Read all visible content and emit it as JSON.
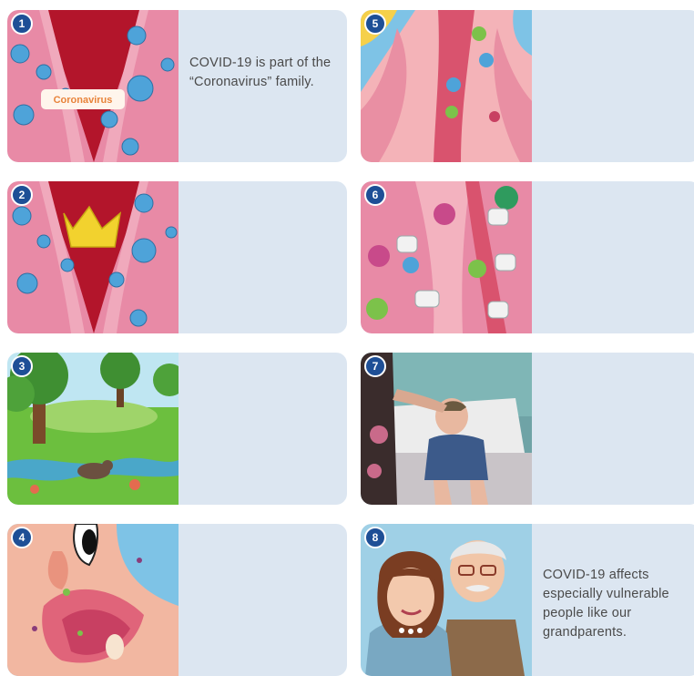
{
  "cards": [
    {
      "badge": "1",
      "caption": "COVID-19 is part of the “Coronavirus” family.",
      "thumb_label": "Coronavirus",
      "scene": "pink-virus-throat"
    },
    {
      "badge": "2",
      "caption": "",
      "scene": "pink-virus-crown"
    },
    {
      "badge": "3",
      "caption": "",
      "scene": "forest-animals"
    },
    {
      "badge": "4",
      "caption": "",
      "scene": "mouth-closeup"
    },
    {
      "badge": "5",
      "caption": "",
      "scene": "throat-viruses"
    },
    {
      "badge": "6",
      "caption": "",
      "scene": "immune-cells-fighting"
    },
    {
      "badge": "7",
      "caption": "",
      "scene": "sick-child-in-bed"
    },
    {
      "badge": "8",
      "caption": "COVID-19 affects especially vulnerable people like our grandparents.",
      "scene": "grandparents"
    }
  ],
  "colors": {
    "card_bg": "#dce6f1",
    "badge": "#1e4f96",
    "caption": "#4a4a4a"
  }
}
